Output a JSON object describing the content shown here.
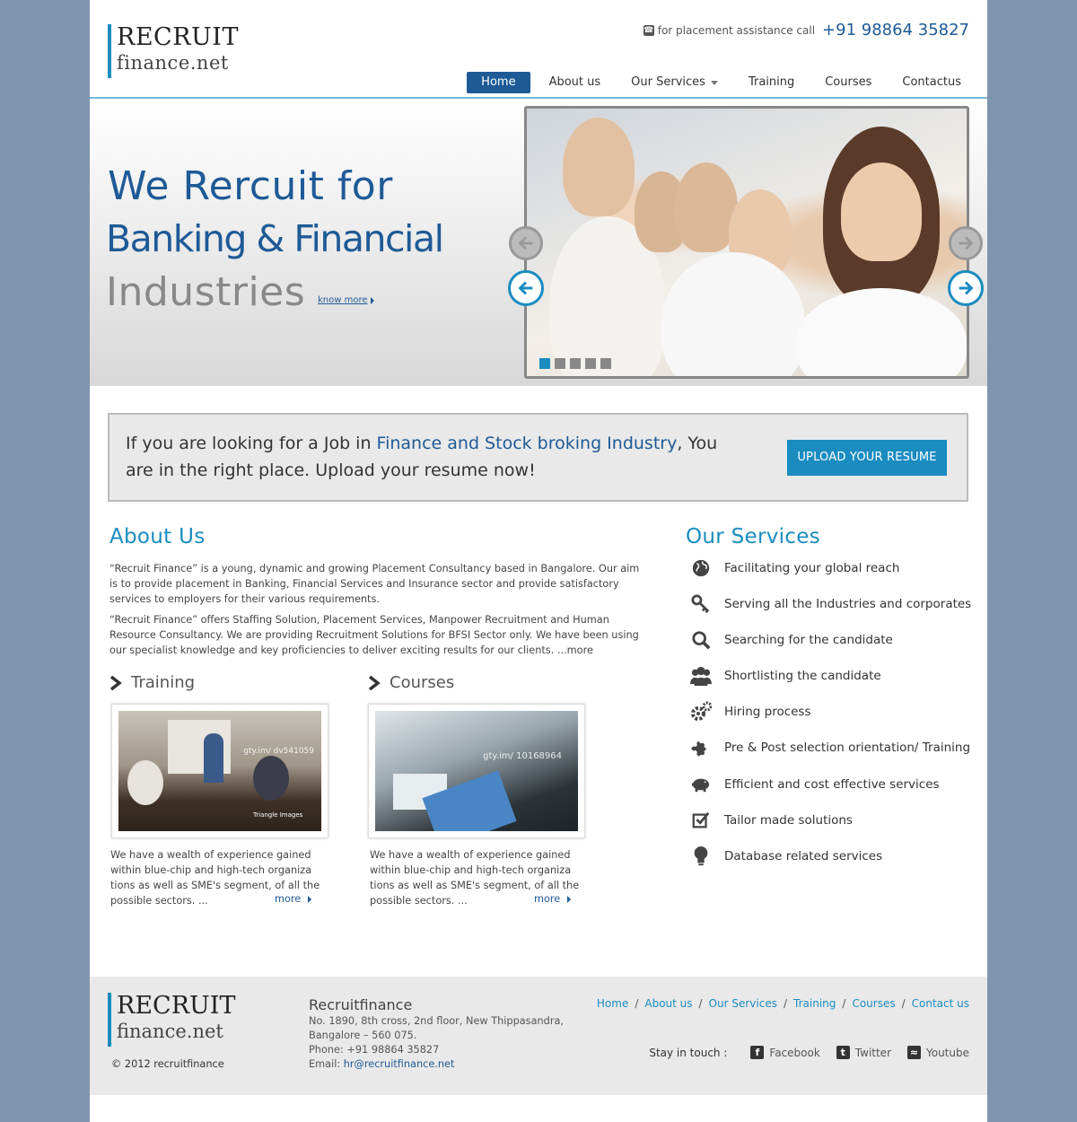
{
  "header": {
    "logo_line1": "RECRUIT",
    "logo_line2": "finance.net",
    "call_text": "for placement assistance call",
    "phone": "+91 98864 35827"
  },
  "nav": {
    "items": [
      "Home",
      "About us",
      "Our Services",
      "Training",
      "Courses",
      "Contactus"
    ]
  },
  "hero": {
    "line1": "We Rercuit for",
    "line2": "Banking & Financial",
    "line3": "Industries",
    "know_more": "know more",
    "slider_dots": 5,
    "active_dot": 1
  },
  "banner": {
    "text_before": "If you are looking for a Job in ",
    "text_highlight": "Finance and Stock broking Industry",
    "text_after": ", You are in the right place. Upload your resume now!",
    "button": "UPLOAD YOUR RESUME"
  },
  "about": {
    "title": "About Us",
    "p1": "“Recruit Finance” is a young, dynamic and growing Placement Consultancy based in Bangalore. Our aim is to provide placement in Banking, Financial Services and Insurance sector and provide satisfactory services to employers for their various requirements.",
    "p2": "“Recruit Finance” offers Staffing Solution, Placement Services, Manpower Recruitment and Human Resource Consultancy. We are providing Recruitment Solutions for BFSI Sector only. We have been using our specialist knowledge and key proficiencies to deliver exciting results for our clients. ...more"
  },
  "cards": [
    {
      "title": "Training",
      "watermark": "gty.im/ dv541059",
      "watermark2": "Triangle Images",
      "text": "We have a wealth of experience gained within blue-chip and high-tech organiza tions as well as SME's segment, of all the possible sectors. ...",
      "more": "more"
    },
    {
      "title": "Courses",
      "watermark": "gty.im/ 10168964",
      "text": "We have a wealth of experience gained within blue-chip and high-tech organiza tions as well as SME's segment, of all the possible sectors. ...",
      "more": "more"
    }
  ],
  "services": {
    "title": "Our Services",
    "items": [
      {
        "label": "Facilitating your global reach",
        "icon": "globe-icon"
      },
      {
        "label": "Serving all the Industries and corporates",
        "icon": "key-icon"
      },
      {
        "label": "Searching for the candidate",
        "icon": "search-icon"
      },
      {
        "label": "Shortlisting the candidate",
        "icon": "users-icon"
      },
      {
        "label": "Hiring process",
        "icon": "gears-icon"
      },
      {
        "label": "Pre & Post selection orientation/ Training",
        "icon": "puzzle-icon"
      },
      {
        "label": "Efficient and cost effective services",
        "icon": "piggy-bank-icon"
      },
      {
        "label": "Tailor made solutions",
        "icon": "checkbox-icon"
      },
      {
        "label": "Database related services",
        "icon": "lightbulb-icon"
      }
    ]
  },
  "footer": {
    "logo_line1": "RECRUIT",
    "logo_line2": "finance.net",
    "copyright": "© 2012 recruitfinance",
    "company": "Recruitfinance",
    "address1": "No. 1890, 8th cross, 2nd floor, New Thippasandra,",
    "address2": "Bangalore – 560 075.",
    "phone": "Phone: +91 98864 35827",
    "email_label": "Email: ",
    "email": "hr@recruitfinance.net",
    "links": [
      "Home",
      "About us",
      "Our Services",
      "Training",
      "Courses",
      "Contact us"
    ],
    "stay_in_touch": "Stay in touch :",
    "social": [
      "Facebook",
      "Twitter",
      "Youtube"
    ]
  },
  "colors": {
    "brand_blue": "#1e5a96",
    "accent_blue": "#1a8cc0",
    "outer_bg": "#7d96ae"
  }
}
